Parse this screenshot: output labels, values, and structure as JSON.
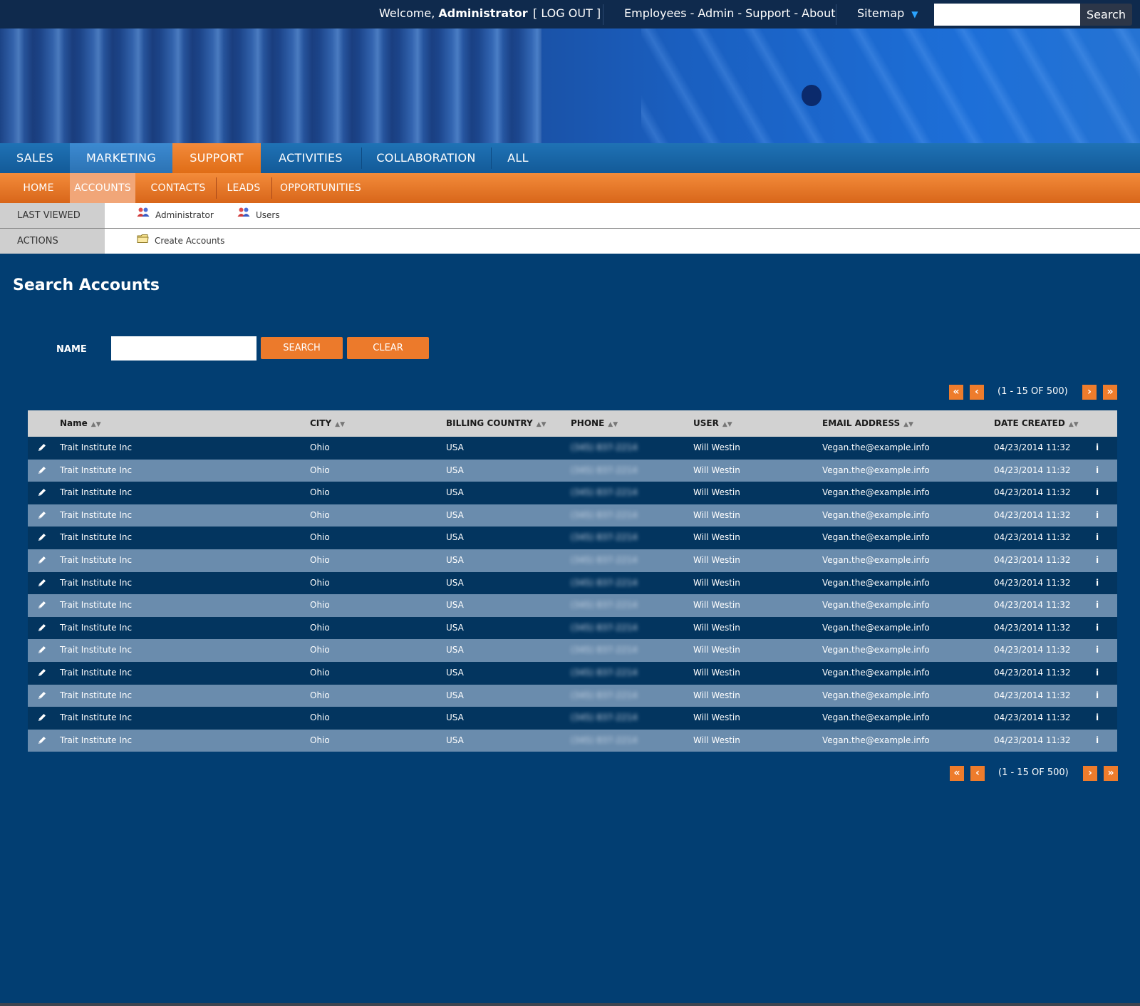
{
  "topbar": {
    "welcome_prefix": "Welcome,",
    "welcome_user": "Administrator",
    "logout": "[ LOG OUT ]",
    "links": [
      "Employees",
      "Admin",
      "Support",
      "About"
    ],
    "link_separator": "-",
    "sitemap": "Sitemap",
    "search_value": "",
    "search_button": "Search"
  },
  "main_nav": [
    "SALES",
    "MARKETING",
    "SUPPORT",
    "ACTIVITIES",
    "COLLABORATION",
    "ALL"
  ],
  "main_nav_active": "SUPPORT",
  "sub_nav": [
    "HOME",
    "ACCOUNTS",
    "CONTACTS",
    "LEADS",
    "OPPORTUNITIES"
  ],
  "sub_nav_active": "ACCOUNTS",
  "last_viewed": {
    "label": "LAST VIEWED",
    "items": [
      "Administrator",
      "Users"
    ]
  },
  "actions": {
    "label": "ACTIONS",
    "items": [
      "Create Accounts"
    ]
  },
  "search": {
    "title": "Search Accounts",
    "name_label": "NAME",
    "name_value": "",
    "search_button": "SEARCH",
    "clear_button": "CLEAR"
  },
  "pager": {
    "first": "«",
    "prev": "‹",
    "next": "›",
    "last": "»",
    "text": "(1 - 15 OF 500)"
  },
  "table": {
    "columns": [
      "Name",
      "CITY",
      "BILLING COUNTRY",
      "PHONE",
      "USER",
      "EMAIL ADDRESS",
      "DATE CREATED"
    ],
    "rows": [
      {
        "name": "Trait Institute Inc",
        "city": "Ohio",
        "country": "USA",
        "phone": "(345) 837-2214",
        "user": "Will Westin",
        "email": "Vegan.the@example.info",
        "date": "04/23/2014 11:32"
      },
      {
        "name": "Trait Institute Inc",
        "city": "Ohio",
        "country": "USA",
        "phone": "(345) 837-2214",
        "user": "Will Westin",
        "email": "Vegan.the@example.info",
        "date": "04/23/2014 11:32"
      },
      {
        "name": "Trait Institute Inc",
        "city": "Ohio",
        "country": "USA",
        "phone": "(345) 837-2214",
        "user": "Will Westin",
        "email": "Vegan.the@example.info",
        "date": "04/23/2014 11:32"
      },
      {
        "name": "Trait Institute Inc",
        "city": "Ohio",
        "country": "USA",
        "phone": "(345) 837-2214",
        "user": "Will Westin",
        "email": "Vegan.the@example.info",
        "date": "04/23/2014 11:32"
      },
      {
        "name": "Trait Institute Inc",
        "city": "Ohio",
        "country": "USA",
        "phone": "(345) 837-2214",
        "user": "Will Westin",
        "email": "Vegan.the@example.info",
        "date": "04/23/2014 11:32"
      },
      {
        "name": "Trait Institute Inc",
        "city": "Ohio",
        "country": "USA",
        "phone": "(345) 837-2214",
        "user": "Will Westin",
        "email": "Vegan.the@example.info",
        "date": "04/23/2014 11:32"
      },
      {
        "name": "Trait Institute Inc",
        "city": "Ohio",
        "country": "USA",
        "phone": "(345) 837-2214",
        "user": "Will Westin",
        "email": "Vegan.the@example.info",
        "date": "04/23/2014 11:32"
      },
      {
        "name": "Trait Institute Inc",
        "city": "Ohio",
        "country": "USA",
        "phone": "(345) 837-2214",
        "user": "Will Westin",
        "email": "Vegan.the@example.info",
        "date": "04/23/2014 11:32"
      },
      {
        "name": "Trait Institute Inc",
        "city": "Ohio",
        "country": "USA",
        "phone": "(345) 837-2214",
        "user": "Will Westin",
        "email": "Vegan.the@example.info",
        "date": "04/23/2014 11:32"
      },
      {
        "name": "Trait Institute Inc",
        "city": "Ohio",
        "country": "USA",
        "phone": "(345) 837-2214",
        "user": "Will Westin",
        "email": "Vegan.the@example.info",
        "date": "04/23/2014 11:32"
      },
      {
        "name": "Trait Institute Inc",
        "city": "Ohio",
        "country": "USA",
        "phone": "(345) 837-2214",
        "user": "Will Westin",
        "email": "Vegan.the@example.info",
        "date": "04/23/2014 11:32"
      },
      {
        "name": "Trait Institute Inc",
        "city": "Ohio",
        "country": "USA",
        "phone": "(345) 837-2214",
        "user": "Will Westin",
        "email": "Vegan.the@example.info",
        "date": "04/23/2014 11:32"
      },
      {
        "name": "Trait Institute Inc",
        "city": "Ohio",
        "country": "USA",
        "phone": "(345) 837-2214",
        "user": "Will Westin",
        "email": "Vegan.the@example.info",
        "date": "04/23/2014 11:32"
      },
      {
        "name": "Trait Institute Inc",
        "city": "Ohio",
        "country": "USA",
        "phone": "(345) 837-2214",
        "user": "Will Westin",
        "email": "Vegan.the@example.info",
        "date": "04/23/2014 11:32"
      }
    ]
  },
  "icons": {
    "edit": "pencil-icon",
    "info": "info-icon",
    "user": "users-icon",
    "folder": "folder-icon",
    "sort": "sort-arrows-icon"
  },
  "colors": {
    "page_bg": "#023e72",
    "accent_orange": "#ec7a2b",
    "nav_blue": "#1a67a8",
    "row_dark": "#03355f",
    "row_light": "#6a8cad"
  }
}
